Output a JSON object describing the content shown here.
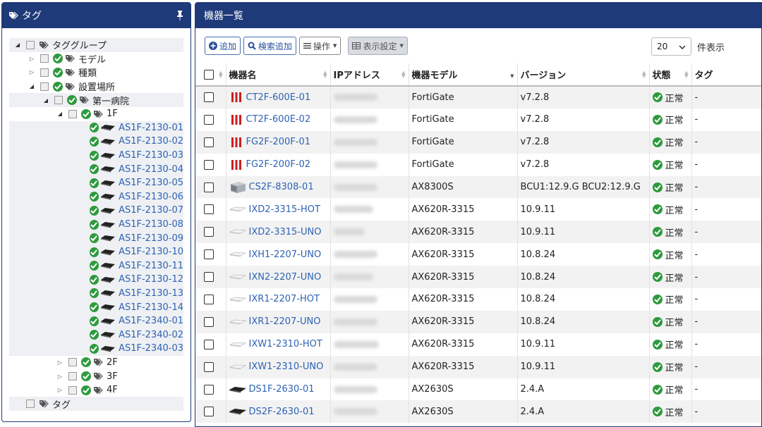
{
  "left_panel": {
    "title": "タグ",
    "tree": [
      {
        "label": "タググループ",
        "level": 0,
        "caret": "open",
        "check": false,
        "tag": true,
        "kind": "group",
        "shaded": true
      },
      {
        "label": "モデル",
        "level": 1,
        "caret": "closed",
        "check": true,
        "tag": true,
        "kind": "group",
        "shaded": false
      },
      {
        "label": "種類",
        "level": 1,
        "caret": "closed",
        "check": true,
        "tag": true,
        "kind": "group",
        "shaded": false
      },
      {
        "label": "設置場所",
        "level": 1,
        "caret": "open",
        "check": true,
        "tag": true,
        "kind": "group",
        "shaded": false
      },
      {
        "label": "第一病院",
        "level": 2,
        "caret": "open",
        "check": true,
        "tag": true,
        "kind": "group",
        "shaded": true
      },
      {
        "label": "1F",
        "level": 3,
        "caret": "open",
        "check": true,
        "tag": true,
        "kind": "group",
        "shaded": false
      },
      {
        "label": "AS1F-2130-01",
        "level": 4,
        "kind": "device",
        "shaded": true
      },
      {
        "label": "AS1F-2130-02",
        "level": 4,
        "kind": "device",
        "shaded": true
      },
      {
        "label": "AS1F-2130-03",
        "level": 4,
        "kind": "device",
        "shaded": true
      },
      {
        "label": "AS1F-2130-04",
        "level": 4,
        "kind": "device",
        "shaded": true
      },
      {
        "label": "AS1F-2130-05",
        "level": 4,
        "kind": "device",
        "shaded": true
      },
      {
        "label": "AS1F-2130-06",
        "level": 4,
        "kind": "device",
        "shaded": true
      },
      {
        "label": "AS1F-2130-07",
        "level": 4,
        "kind": "device",
        "shaded": true
      },
      {
        "label": "AS1F-2130-08",
        "level": 4,
        "kind": "device",
        "shaded": true
      },
      {
        "label": "AS1F-2130-09",
        "level": 4,
        "kind": "device",
        "shaded": true
      },
      {
        "label": "AS1F-2130-10",
        "level": 4,
        "kind": "device",
        "shaded": true
      },
      {
        "label": "AS1F-2130-11",
        "level": 4,
        "kind": "device",
        "shaded": true
      },
      {
        "label": "AS1F-2130-12",
        "level": 4,
        "kind": "device",
        "shaded": true
      },
      {
        "label": "AS1F-2130-13",
        "level": 4,
        "kind": "device",
        "shaded": true
      },
      {
        "label": "AS1F-2130-14",
        "level": 4,
        "kind": "device",
        "shaded": true
      },
      {
        "label": "AS1F-2340-01",
        "level": 4,
        "kind": "device",
        "shaded": true
      },
      {
        "label": "AS1F-2340-02",
        "level": 4,
        "kind": "device",
        "shaded": true
      },
      {
        "label": "AS1F-2340-03",
        "level": 4,
        "kind": "device",
        "shaded": true
      },
      {
        "label": "2F",
        "level": 3,
        "caret": "closed",
        "check": true,
        "tag": true,
        "kind": "group",
        "shaded": false
      },
      {
        "label": "3F",
        "level": 3,
        "caret": "closed",
        "check": true,
        "tag": true,
        "kind": "group",
        "shaded": false
      },
      {
        "label": "4F",
        "level": 3,
        "caret": "closed",
        "check": true,
        "tag": true,
        "kind": "group",
        "shaded": false
      },
      {
        "label": "タグ",
        "level": 0,
        "caret": "none",
        "check": false,
        "tag": true,
        "kind": "group",
        "shaded": true
      }
    ]
  },
  "right_panel": {
    "title": "機器一覧",
    "toolbar": {
      "add_label": "追加",
      "search_add_label": "検索追加",
      "operation_label": "操作",
      "display_settings_label": "表示設定"
    },
    "page_size": {
      "value": "20",
      "label": "件表示"
    },
    "columns": [
      "機器名",
      "IPアドレス",
      "機器モデル",
      "バージョン",
      "状態",
      "タグ"
    ],
    "rows": [
      {
        "name": "CT2F-600E-01",
        "icon": "firewall",
        "model": "FortiGate",
        "version": "v7.2.8",
        "status": "正常",
        "tag": "-"
      },
      {
        "name": "CT2F-600E-02",
        "icon": "firewall",
        "model": "FortiGate",
        "version": "v7.2.8",
        "status": "正常",
        "tag": "-"
      },
      {
        "name": "FG2F-200F-01",
        "icon": "firewall",
        "model": "FortiGate",
        "version": "v7.2.8",
        "status": "正常",
        "tag": "-"
      },
      {
        "name": "FG2F-200F-02",
        "icon": "firewall",
        "model": "FortiGate",
        "version": "v7.2.8",
        "status": "正常",
        "tag": "-"
      },
      {
        "name": "CS2F-8308-01",
        "icon": "chassis",
        "model": "AX8300S",
        "version": "BCU1:12.9.G  BCU2:12.9.G",
        "status": "正常",
        "tag": "-"
      },
      {
        "name": "IXD2-3315-HOT",
        "icon": "router",
        "model": "AX620R-3315",
        "version": "10.9.11",
        "status": "正常",
        "tag": "-"
      },
      {
        "name": "IXD2-3315-UNO",
        "icon": "router",
        "model": "AX620R-3315",
        "version": "10.9.11",
        "status": "正常",
        "tag": "-"
      },
      {
        "name": "IXH1-2207-UNO",
        "icon": "router",
        "model": "AX620R-3315",
        "version": "10.8.24",
        "status": "正常",
        "tag": "-"
      },
      {
        "name": "IXN2-2207-UNO",
        "icon": "router",
        "model": "AX620R-3315",
        "version": "10.8.24",
        "status": "正常",
        "tag": "-"
      },
      {
        "name": "IXR1-2207-HOT",
        "icon": "router",
        "model": "AX620R-3315",
        "version": "10.8.24",
        "status": "正常",
        "tag": "-"
      },
      {
        "name": "IXR1-2207-UNO",
        "icon": "router",
        "model": "AX620R-3315",
        "version": "10.8.24",
        "status": "正常",
        "tag": "-"
      },
      {
        "name": "IXW1-2310-HOT",
        "icon": "router",
        "model": "AX620R-3315",
        "version": "10.9.11",
        "status": "正常",
        "tag": "-"
      },
      {
        "name": "IXW1-2310-UNO",
        "icon": "router",
        "model": "AX620R-3315",
        "version": "10.9.11",
        "status": "正常",
        "tag": "-"
      },
      {
        "name": "DS1F-2630-01",
        "icon": "switch",
        "model": "AX2630S",
        "version": "2.4.A",
        "status": "正常",
        "tag": "-"
      },
      {
        "name": "DS2F-2630-01",
        "icon": "switch",
        "model": "AX2630S",
        "version": "2.4.A",
        "status": "正常",
        "tag": "-"
      }
    ]
  },
  "colors": {
    "header_bg": "#1e3a78",
    "link": "#2e63b4",
    "ok_green": "#2e9a3e",
    "firewall_red": "#cc1f1f"
  }
}
